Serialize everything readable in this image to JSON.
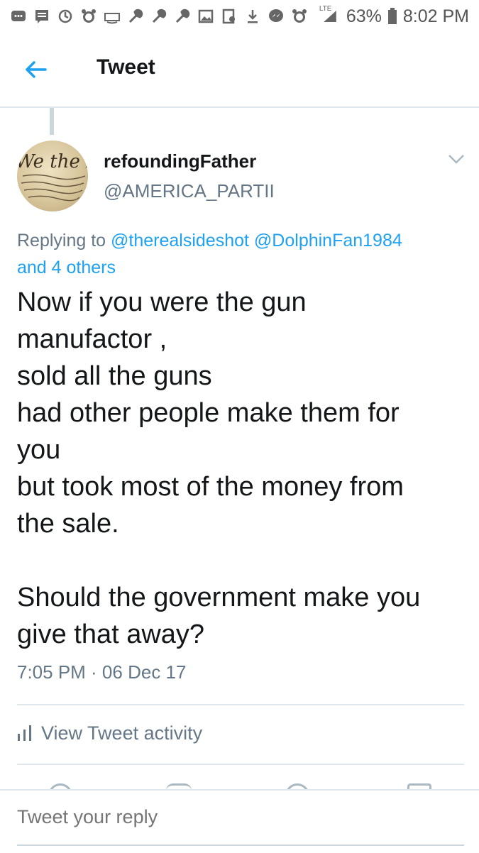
{
  "status_bar": {
    "icons": [
      "messages-icon",
      "sms-icon",
      "notification-icon",
      "alarm-icon",
      "amazon-icon",
      "wrench-icon",
      "wrench-icon",
      "wrench-icon",
      "image-icon",
      "screenshot-icon",
      "download-icon",
      "messenger-icon",
      "alarm-icon"
    ],
    "network": "LTE",
    "battery": "63%",
    "time": "8:02 PM"
  },
  "header": {
    "title": "Tweet"
  },
  "tweet": {
    "display_name": "refoundingFather",
    "handle": "@AMERICA_PARTII",
    "replying_prefix": "Replying to",
    "replying_users": [
      "@therealsideshot",
      "@DolphinFan1984"
    ],
    "replying_others": "and 4 others",
    "text": "Now if you were the gun\nmanufactor ,\nsold all the guns\nhad other people make them for\nyou\nbut took most of the money from\nthe sale.\n\nShould the government make you\ngive that away?",
    "timestamp": "7:05 PM · 06 Dec 17",
    "activity_label": "View Tweet activity"
  },
  "reply": {
    "placeholder": "Tweet your reply"
  },
  "colors": {
    "accent": "#1da1f2",
    "secondary_text": "#657786",
    "divider": "#e1e8ed"
  }
}
